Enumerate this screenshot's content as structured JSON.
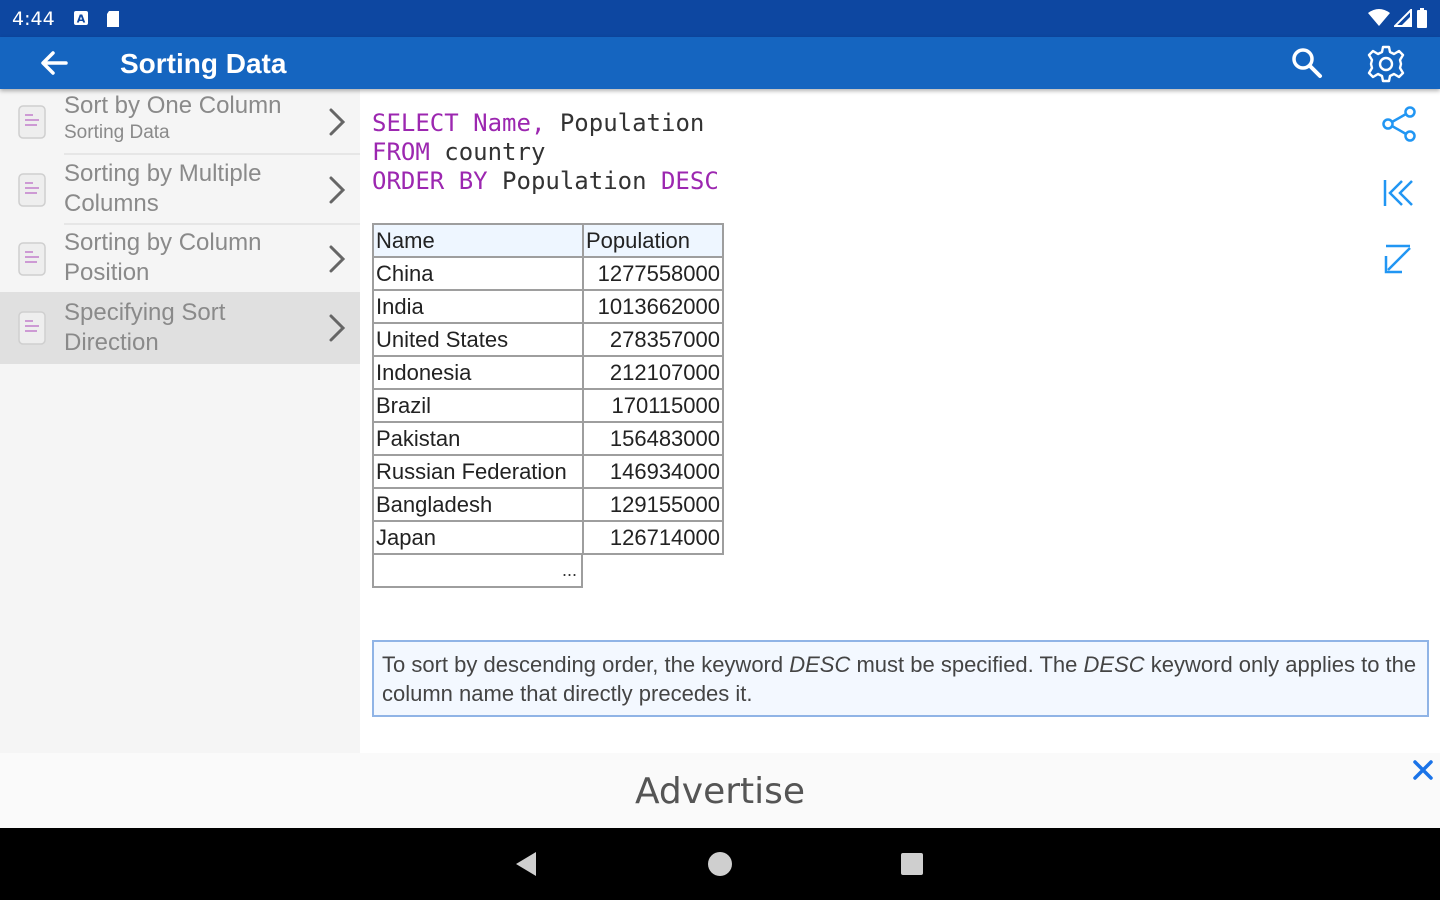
{
  "status_bar": {
    "time": "4:44"
  },
  "app_bar": {
    "title": "Sorting Data"
  },
  "sidebar": {
    "items": [
      {
        "label": "Sort by One Column",
        "sublabel": "Sorting Data"
      },
      {
        "label_line1": "Sorting by Multiple",
        "label_line2": "Columns"
      },
      {
        "label_line1": "Sorting by Column",
        "label_line2": "Position"
      },
      {
        "label_line1": "Specifying Sort",
        "label_line2": "Direction"
      }
    ]
  },
  "query": {
    "line1": {
      "kw": "SELECT",
      "cols_kw": "Name,",
      "rest": " Population"
    },
    "line2": {
      "kw": "FROM",
      "rest": " country"
    },
    "line3": {
      "kw1": "ORDER BY",
      "mid": " Population ",
      "kw2": "DESC"
    }
  },
  "result_table": {
    "headers": [
      "Name",
      "Population"
    ],
    "rows": [
      [
        "China",
        "1277558000"
      ],
      [
        "India",
        "1013662000"
      ],
      [
        "United States",
        "278357000"
      ],
      [
        "Indonesia",
        "212107000"
      ],
      [
        "Brazil",
        "170115000"
      ],
      [
        "Pakistan",
        "156483000"
      ],
      [
        "Russian Federation",
        "146934000"
      ],
      [
        "Bangladesh",
        "129155000"
      ],
      [
        "Japan",
        "126714000"
      ]
    ],
    "more": "..."
  },
  "info": {
    "part1": "To sort by descending order, the keyword ",
    "em1": "DESC",
    "part2": " must be specified. The ",
    "em2": "DESC",
    "part3": " keyword only applies to the column name that directly precedes it."
  },
  "ad": {
    "label": "Advertise"
  },
  "colors": {
    "status_bar": "#0d47a1",
    "app_bar": "#1565c0",
    "keyword": "#9c27b0",
    "accent": "#2196f3"
  },
  "icons": [
    "back-arrow-icon",
    "search-icon",
    "gear-icon",
    "share-icon",
    "first-page-icon",
    "scroll-to-end-icon",
    "close-icon",
    "document-icon",
    "chevron-right-icon"
  ]
}
